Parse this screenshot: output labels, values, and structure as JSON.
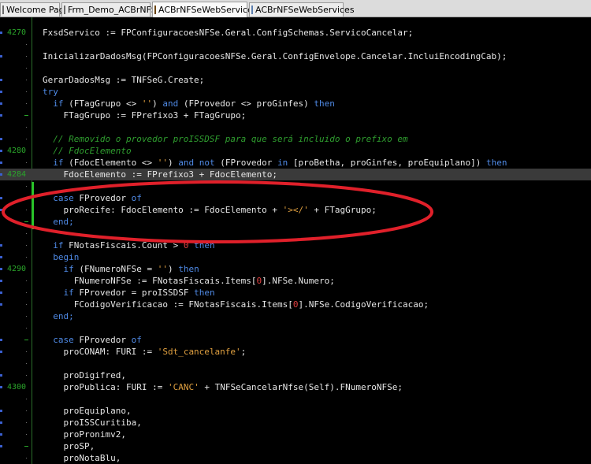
{
  "tabs": [
    {
      "label": "Welcome Page",
      "icon": "grid-icon"
    },
    {
      "label": "Frm_Demo_ACBrNFSe",
      "icon": "grid-icon"
    },
    {
      "label": "ACBrNFSeWebServices",
      "icon": "unit-icon"
    },
    {
      "label": "ACBrNFSeWebServices",
      "icon": "page-icon"
    }
  ],
  "active_tab": 2,
  "colors": {
    "keyword": "#4f8ae6",
    "comment": "#2f9e2f",
    "string": "#e0a040",
    "number": "#e04040",
    "text": "#e6e6e6",
    "gutter": "#2aa62a",
    "annotation": "#e0202a"
  },
  "editor": {
    "highlighted_line": 12,
    "line_numbers": {
      "0": "4270",
      "10": "4280",
      "12": "4284",
      "20": "4290",
      "30": "4300"
    },
    "lines": [
      {
        "parts": [
          {
            "t": "FxsdServico := FPConfiguracoesNFSe.Geral.ConfigSchemas.ServicoCancelar;"
          }
        ]
      },
      {
        "parts": []
      },
      {
        "parts": [
          {
            "t": "InicializarDadosMsg(FPConfiguracoesNFSe.Geral.ConfigEnvelope.Cancelar.IncluiEncodingCab);"
          }
        ]
      },
      {
        "parts": []
      },
      {
        "parts": [
          {
            "t": "GerarDadosMsg := TNFSeG.Create;"
          }
        ]
      },
      {
        "parts": [
          {
            "t": "try",
            "c": "kw"
          }
        ]
      },
      {
        "parts": [
          {
            "t": "  if",
            "c": "kw"
          },
          {
            "t": " (FTagGrupo <> "
          },
          {
            "t": "''",
            "c": "st"
          },
          {
            "t": ") "
          },
          {
            "t": "and",
            "c": "kw"
          },
          {
            "t": " (FProvedor <> proGinfes) "
          },
          {
            "t": "then",
            "c": "kw"
          }
        ]
      },
      {
        "parts": [
          {
            "t": "    FTagGrupo := FPrefixo3 + FTagGrupo;"
          }
        ]
      },
      {
        "parts": []
      },
      {
        "parts": [
          {
            "t": "  // Removido o provedor proISSDSF para que será incluido o prefixo em",
            "c": "cm"
          }
        ]
      },
      {
        "parts": [
          {
            "t": "  // FdocElemento",
            "c": "cm"
          }
        ]
      },
      {
        "parts": [
          {
            "t": "  if",
            "c": "kw"
          },
          {
            "t": " (FdocElemento <> "
          },
          {
            "t": "''",
            "c": "st"
          },
          {
            "t": ") "
          },
          {
            "t": "and not",
            "c": "kw"
          },
          {
            "t": " (FProvedor "
          },
          {
            "t": "in",
            "c": "kw"
          },
          {
            "t": " [proBetha, proGinfes, proEquiplano]) "
          },
          {
            "t": "then",
            "c": "kw"
          }
        ]
      },
      {
        "parts": [
          {
            "t": "    FdocElemento := FPrefixo3 + FdocElemento;"
          }
        ]
      },
      {
        "parts": []
      },
      {
        "parts": [
          {
            "t": "  case",
            "c": "kw"
          },
          {
            "t": " FProvedor "
          },
          {
            "t": "of",
            "c": "kw"
          }
        ]
      },
      {
        "parts": [
          {
            "t": "    proRecife: FdocElemento := FdocElemento + "
          },
          {
            "t": "'></'",
            "c": "st"
          },
          {
            "t": " + FTagGrupo;"
          }
        ]
      },
      {
        "parts": [
          {
            "t": "  end;",
            "c": "kw"
          }
        ]
      },
      {
        "parts": []
      },
      {
        "parts": [
          {
            "t": "  if",
            "c": "kw"
          },
          {
            "t": " FNotasFiscais.Count > "
          },
          {
            "t": "0",
            "c": "nm"
          },
          {
            "t": " "
          },
          {
            "t": "then",
            "c": "kw"
          }
        ]
      },
      {
        "parts": [
          {
            "t": "  begin",
            "c": "kw"
          }
        ]
      },
      {
        "parts": [
          {
            "t": "    if",
            "c": "kw"
          },
          {
            "t": " (FNumeroNFSe = "
          },
          {
            "t": "''",
            "c": "st"
          },
          {
            "t": ") "
          },
          {
            "t": "then",
            "c": "kw"
          }
        ]
      },
      {
        "parts": [
          {
            "t": "      FNumeroNFSe := FNotasFiscais.Items["
          },
          {
            "t": "0",
            "c": "nm"
          },
          {
            "t": "].NFSe.Numero;"
          }
        ]
      },
      {
        "parts": [
          {
            "t": "    if",
            "c": "kw"
          },
          {
            "t": " FProvedor = proISSDSF "
          },
          {
            "t": "then",
            "c": "kw"
          }
        ]
      },
      {
        "parts": [
          {
            "t": "      FCodigoVerificacao := FNotasFiscais.Items["
          },
          {
            "t": "0",
            "c": "nm"
          },
          {
            "t": "].NFSe.CodigoVerificacao;"
          }
        ]
      },
      {
        "parts": [
          {
            "t": "  end;",
            "c": "kw"
          }
        ]
      },
      {
        "parts": []
      },
      {
        "parts": [
          {
            "t": "  case",
            "c": "kw"
          },
          {
            "t": " FProvedor "
          },
          {
            "t": "of",
            "c": "kw"
          }
        ]
      },
      {
        "parts": [
          {
            "t": "    proCONAM: FURI := "
          },
          {
            "t": "'Sdt_cancelanfe'",
            "c": "st"
          },
          {
            "t": ";"
          }
        ]
      },
      {
        "parts": []
      },
      {
        "parts": [
          {
            "t": "    proDigifred,"
          }
        ]
      },
      {
        "parts": [
          {
            "t": "    proPublica: FURI := "
          },
          {
            "t": "'CANC'",
            "c": "st"
          },
          {
            "t": " + TNFSeCancelarNfse(Self).FNumeroNFSe;"
          }
        ]
      },
      {
        "parts": []
      },
      {
        "parts": [
          {
            "t": "    proEquiplano,"
          }
        ]
      },
      {
        "parts": [
          {
            "t": "    proISSCuritiba,"
          }
        ]
      },
      {
        "parts": [
          {
            "t": "    proPronimv2,"
          }
        ]
      },
      {
        "parts": [
          {
            "t": "    proSP,"
          }
        ]
      },
      {
        "parts": [
          {
            "t": "    proNotaBlu,"
          }
        ]
      }
    ]
  }
}
